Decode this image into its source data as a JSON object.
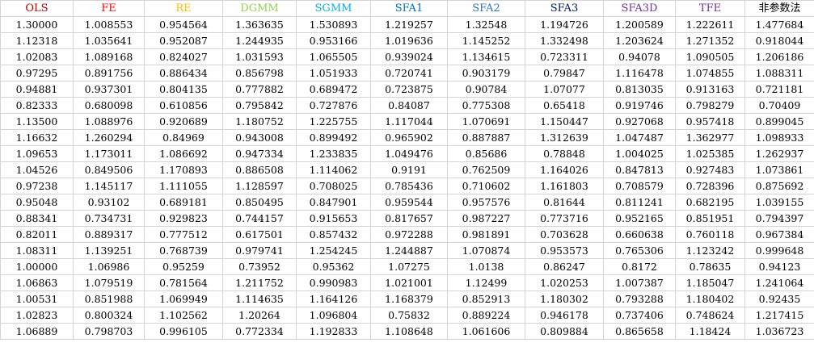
{
  "columns": [
    {
      "label": "OLS",
      "color": "#c00000"
    },
    {
      "label": "FE",
      "color": "#ff0000"
    },
    {
      "label": "RE",
      "color": "#ffc000"
    },
    {
      "label": "DGMM",
      "color": "#92d050"
    },
    {
      "label": "SGMM",
      "color": "#00b0f0"
    },
    {
      "label": "SFA1",
      "color": "#0070c0"
    },
    {
      "label": "SFA2",
      "color": "#2e75b6"
    },
    {
      "label": "SFA3",
      "color": "#002060"
    },
    {
      "label": "SFA3D",
      "color": "#7030a0"
    },
    {
      "label": "TFE",
      "color": "#7030a0"
    },
    {
      "label": "非参数法",
      "color": "#000000"
    }
  ],
  "rows": [
    [
      "1.30000",
      "1.008553",
      "0.954564",
      "1.363635",
      "1.530893",
      "1.219257",
      "1.32548",
      "1.194726",
      "1.200589",
      "1.222611",
      "1.477684"
    ],
    [
      "1.12318",
      "1.035641",
      "0.952087",
      "1.244935",
      "0.953166",
      "1.019636",
      "1.145252",
      "1.332498",
      "1.203624",
      "1.271352",
      "0.918044"
    ],
    [
      "1.02083",
      "1.089168",
      "0.824027",
      "1.031593",
      "1.065505",
      "0.939024",
      "1.134615",
      "0.723311",
      "0.94078",
      "1.090505",
      "1.206186"
    ],
    [
      "0.97295",
      "0.891756",
      "0.886434",
      "0.856798",
      "1.051933",
      "0.720741",
      "0.903179",
      "0.79847",
      "1.116478",
      "1.074855",
      "1.088311"
    ],
    [
      "0.94881",
      "0.937301",
      "0.804135",
      "0.777882",
      "0.689472",
      "0.723875",
      "0.90784",
      "1.07077",
      "0.813035",
      "0.913163",
      "0.721181"
    ],
    [
      "0.82333",
      "0.680098",
      "0.610856",
      "0.795842",
      "0.727876",
      "0.84087",
      "0.775308",
      "0.65418",
      "0.919746",
      "0.798279",
      "0.70409"
    ],
    [
      "1.13500",
      "1.088976",
      "0.920689",
      "1.180752",
      "1.225755",
      "1.117044",
      "1.070691",
      "1.150447",
      "0.927068",
      "0.957418",
      "0.899045"
    ],
    [
      "1.16632",
      "1.260294",
      "0.84969",
      "0.943008",
      "0.899492",
      "0.965902",
      "0.887887",
      "1.312639",
      "1.047487",
      "1.362977",
      "1.098933"
    ],
    [
      "1.09653",
      "1.173011",
      "1.086692",
      "0.947334",
      "1.233835",
      "1.049476",
      "0.85686",
      "0.78848",
      "1.004025",
      "1.025385",
      "1.262937"
    ],
    [
      "1.04526",
      "0.849506",
      "1.170893",
      "0.886508",
      "1.114062",
      "0.9191",
      "0.762509",
      "1.164026",
      "0.847813",
      "0.927483",
      "1.073861"
    ],
    [
      "0.97238",
      "1.145117",
      "1.111055",
      "1.128597",
      "0.708025",
      "0.785436",
      "0.710602",
      "1.161803",
      "0.708579",
      "0.728396",
      "0.875692"
    ],
    [
      "0.95048",
      "0.93102",
      "0.689181",
      "0.850495",
      "0.847901",
      "0.959544",
      "0.957576",
      "0.81644",
      "0.811241",
      "0.682195",
      "1.039155"
    ],
    [
      "0.88341",
      "0.734731",
      "0.929823",
      "0.744157",
      "0.915653",
      "0.817657",
      "0.987227",
      "0.773716",
      "0.952165",
      "0.851951",
      "0.794397"
    ],
    [
      "0.82011",
      "0.889317",
      "0.777512",
      "0.617501",
      "0.857432",
      "0.972288",
      "0.981891",
      "0.703628",
      "0.660638",
      "0.760118",
      "0.967384"
    ],
    [
      "1.08311",
      "1.139251",
      "0.768739",
      "0.979741",
      "1.254245",
      "1.244887",
      "1.070874",
      "0.953573",
      "0.765306",
      "1.123242",
      "0.999648"
    ],
    [
      "1.00000",
      "1.06986",
      "0.95259",
      "0.73952",
      "0.95362",
      "1.07275",
      "1.0138",
      "0.86247",
      "0.8172",
      "0.78635",
      "0.94123"
    ],
    [
      "1.06863",
      "1.079519",
      "0.781564",
      "1.211752",
      "0.990983",
      "1.021001",
      "1.12499",
      "1.020253",
      "1.007387",
      "1.185047",
      "1.241064"
    ],
    [
      "1.00531",
      "0.851988",
      "1.069949",
      "1.114635",
      "1.164126",
      "1.168379",
      "0.852913",
      "1.180302",
      "0.793288",
      "1.180402",
      "0.92435"
    ],
    [
      "1.02823",
      "0.800324",
      "1.102562",
      "1.20264",
      "1.096804",
      "0.75832",
      "0.889224",
      "0.946178",
      "0.737406",
      "0.748624",
      "1.217415"
    ],
    [
      "1.06889",
      "0.798703",
      "0.996105",
      "0.772334",
      "1.192833",
      "1.108648",
      "1.061606",
      "0.809884",
      "0.865658",
      "1.18424",
      "1.036723"
    ]
  ]
}
